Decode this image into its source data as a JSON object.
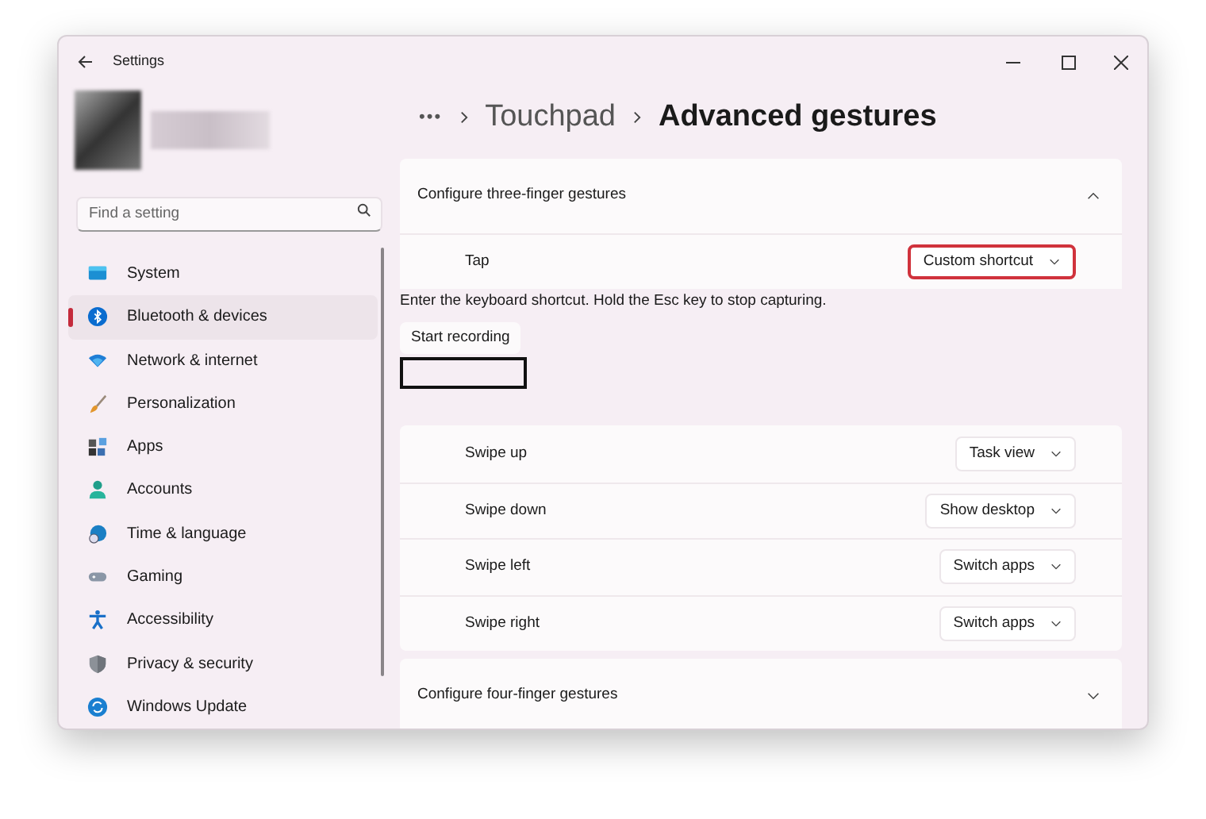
{
  "window": {
    "title": "Settings"
  },
  "search": {
    "placeholder": "Find a setting"
  },
  "sidebar": {
    "items": [
      {
        "label": "System",
        "selected": false
      },
      {
        "label": "Bluetooth & devices",
        "selected": true
      },
      {
        "label": "Network & internet",
        "selected": false
      },
      {
        "label": "Personalization",
        "selected": false
      },
      {
        "label": "Apps",
        "selected": false
      },
      {
        "label": "Accounts",
        "selected": false
      },
      {
        "label": "Time & language",
        "selected": false
      },
      {
        "label": "Gaming",
        "selected": false
      },
      {
        "label": "Accessibility",
        "selected": false
      },
      {
        "label": "Privacy & security",
        "selected": false
      },
      {
        "label": "Windows Update",
        "selected": false
      }
    ]
  },
  "breadcrumb": {
    "more": "•••",
    "items": [
      "Touchpad",
      "Advanced gestures"
    ]
  },
  "sections": [
    {
      "title": "Configure three-finger gestures",
      "expanded": true,
      "tap": {
        "label": "Tap",
        "value": "Custom shortcut",
        "highlighted": true
      },
      "recorder": {
        "instruction": "Enter the keyboard shortcut. Hold the Esc key to stop capturing.",
        "button": "Start recording"
      },
      "rows": [
        {
          "label": "Swipe up",
          "value": "Task view"
        },
        {
          "label": "Swipe down",
          "value": "Show desktop"
        },
        {
          "label": "Swipe left",
          "value": "Switch apps"
        },
        {
          "label": "Swipe right",
          "value": "Switch apps"
        }
      ]
    },
    {
      "title": "Configure four-finger gestures",
      "expanded": false
    }
  ]
}
